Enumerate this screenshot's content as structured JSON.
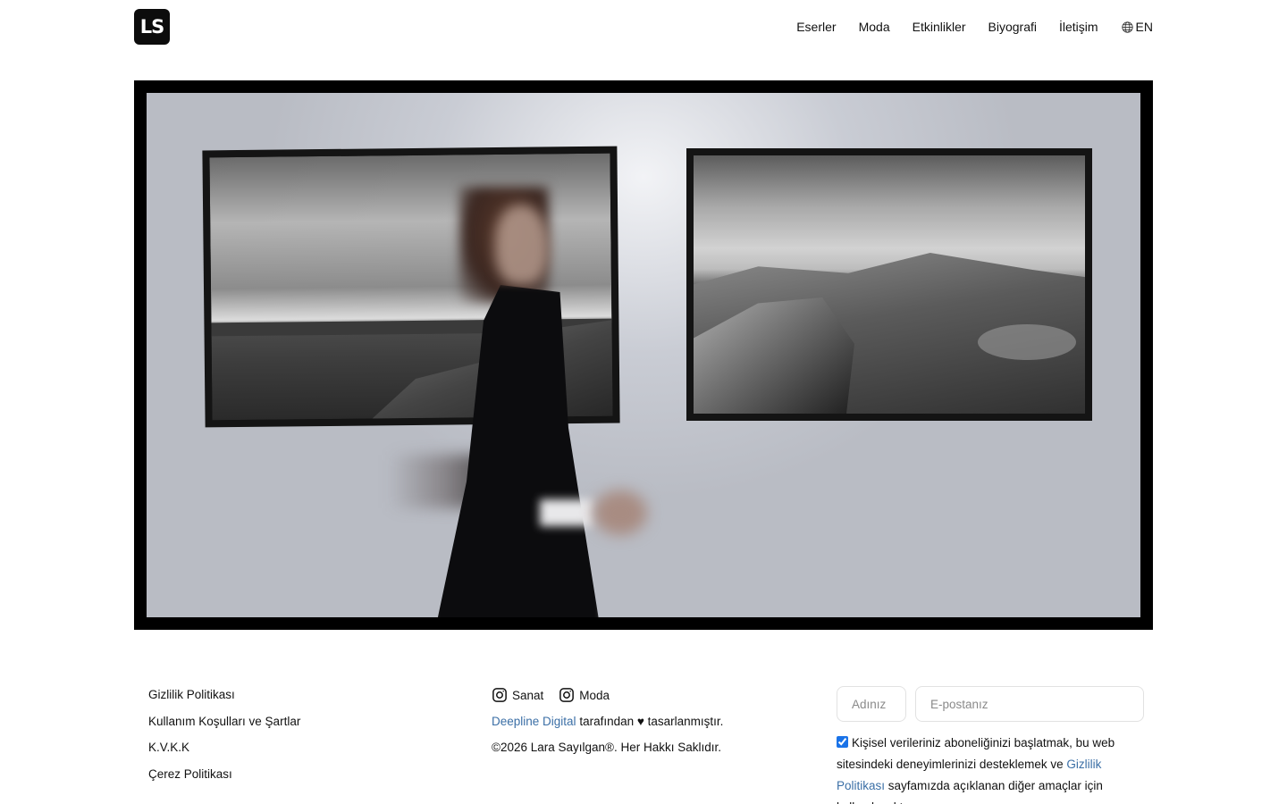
{
  "header": {
    "logo_text": "LS",
    "nav": [
      "Eserler",
      "Moda",
      "Etkinlikler",
      "Biyografi",
      "İletişim"
    ],
    "language": "EN"
  },
  "footer": {
    "links": [
      "Gizlilik Politikası",
      "Kullanım Koşulları ve Şartlar",
      "K.V.K.K",
      "Çerez Politikası"
    ],
    "social": [
      {
        "label": "Sanat",
        "icon": "instagram-icon"
      },
      {
        "label": "Moda",
        "icon": "instagram-icon"
      }
    ],
    "credit_link": "Deepline Digital",
    "credit_text": " tarafından ♥ tasarlanmıştır.",
    "copyright": "©2026 Lara Sayılgan®. Her Hakkı Saklıdır.",
    "form": {
      "name_placeholder": "Adınız",
      "email_placeholder": "E-postanız",
      "consent_checked": true,
      "consent_before": "Kişisel verileriniz aboneliğinizi başlatmak, bu web sitesindeki deneyimlerinizi desteklemek ve ",
      "consent_link": "Gizlilik Politikası",
      "consent_after": " sayfamızda açıklanan diğer amaçlar için kullanılacaktır."
    }
  },
  "colors": {
    "accent_link": "#3b6fa6",
    "checkbox": "#1a73e8",
    "logo_bg": "#0c0c0c"
  }
}
